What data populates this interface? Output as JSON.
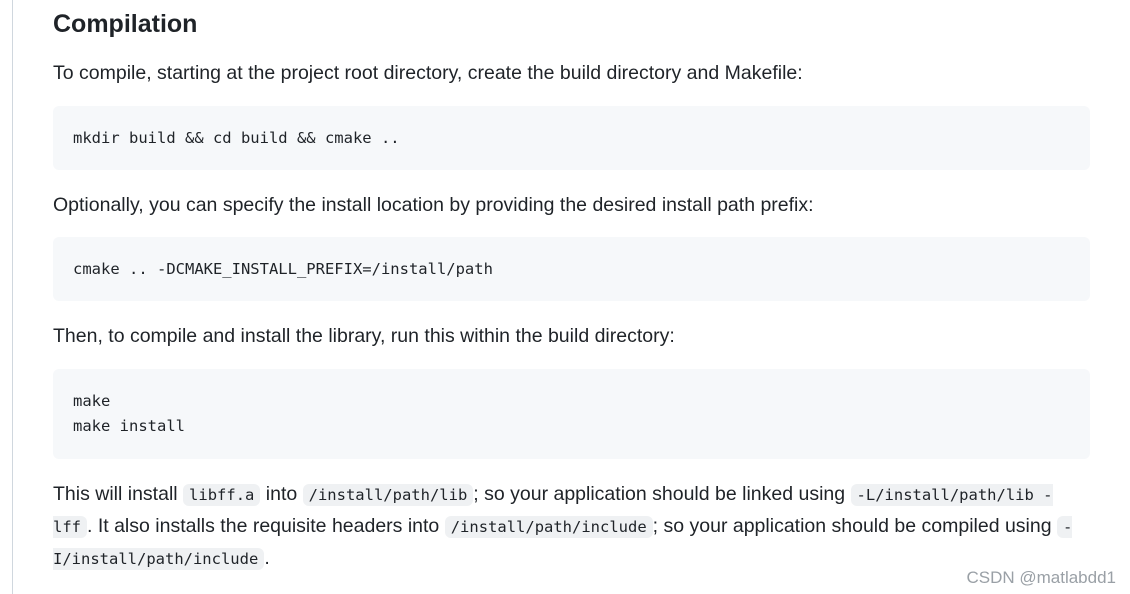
{
  "section": {
    "heading": "Compilation"
  },
  "paragraphs": {
    "intro": "To compile, starting at the project root directory, create the build directory and Makefile:",
    "optional": "Optionally, you can specify the install location by providing the desired install path prefix:",
    "then": "Then, to compile and install the library, run this within the build directory:"
  },
  "code_blocks": {
    "build": "mkdir build && cd build && cmake ..",
    "prefix": "cmake .. -DCMAKE_INSTALL_PREFIX=/install/path",
    "make": "make\nmake install"
  },
  "install_note": {
    "t1": "This will install ",
    "c1": "libff.a",
    "t2": " into ",
    "c2": "/install/path/lib",
    "t3": "; so your application should be linked using ",
    "c3": "-L/install/path/lib -lff",
    "t4": ". It also installs the requisite headers into ",
    "c4": "/install/path/include",
    "t5": "; so your application should be compiled using ",
    "c5": "-I/install/path/include",
    "t6": "."
  },
  "watermark": "CSDN @matlabdd1"
}
